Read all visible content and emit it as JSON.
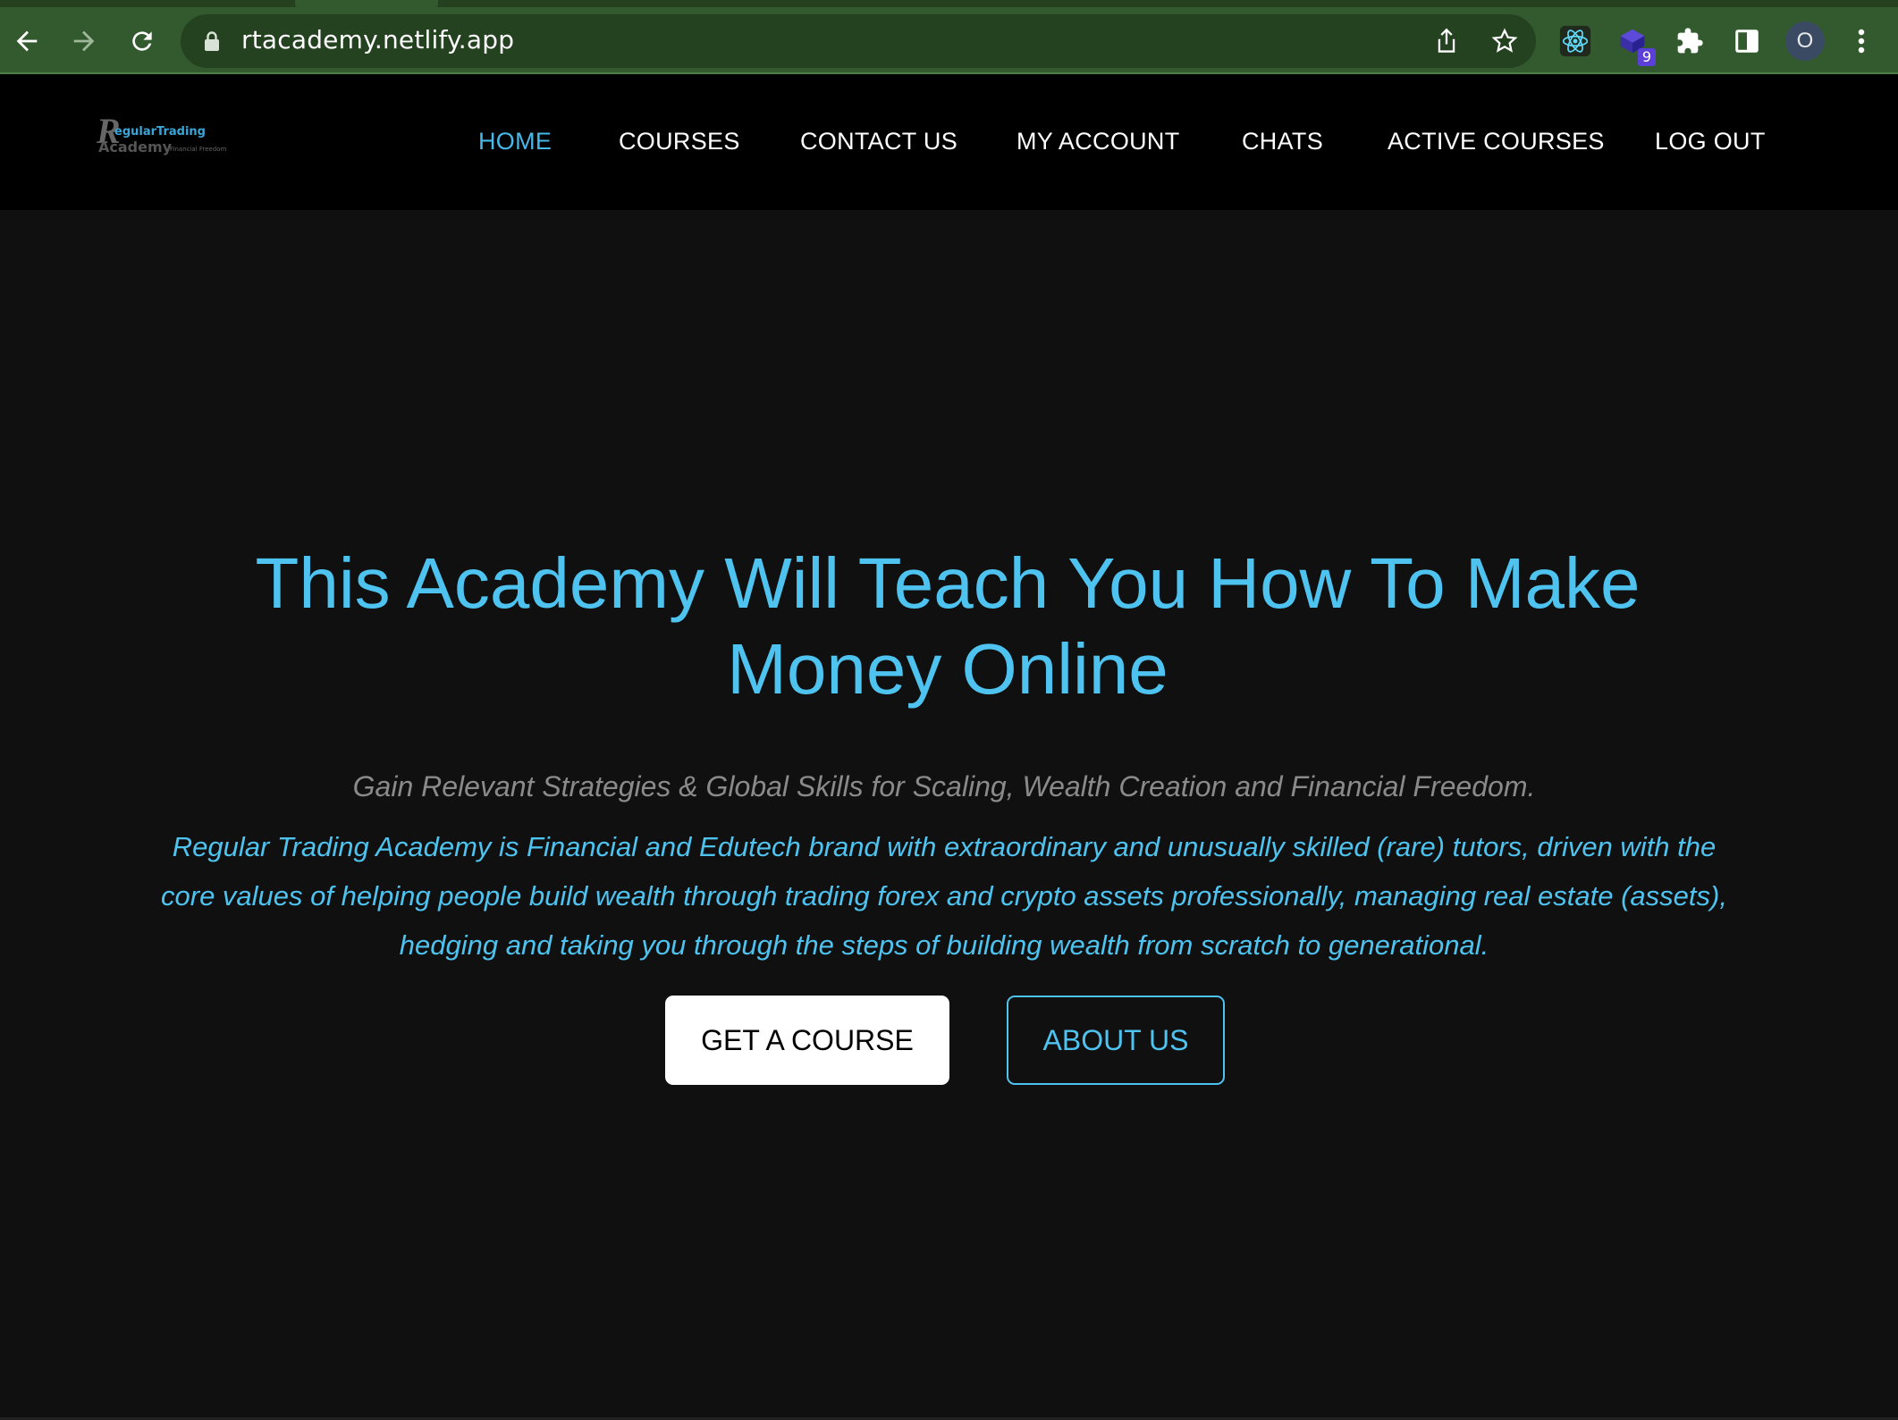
{
  "browser": {
    "url": "rtacademy.netlify.app",
    "extension_badge": "9",
    "profile_initial": "O"
  },
  "site": {
    "logo": {
      "letter": "R",
      "line1": "egularTrading",
      "line2": "Academy",
      "line3": "Financial Freedom"
    },
    "nav": [
      {
        "label": "HOME",
        "active": true
      },
      {
        "label": "COURSES",
        "active": false
      },
      {
        "label": "CONTACT US",
        "active": false
      },
      {
        "label": "MY ACCOUNT",
        "active": false
      },
      {
        "label": "CHATS",
        "active": false
      },
      {
        "label": "ACTIVE COURSES",
        "active": false
      },
      {
        "label": "LOG OUT",
        "active": false
      }
    ]
  },
  "hero": {
    "title_line1": "This Academy Will Teach You How To Make",
    "title_line2": "Money Online",
    "tagline": "Gain Relevant Strategies & Global Skills for Scaling, Wealth Creation and Financial Freedom.",
    "description": "Regular Trading Academy is Financial and Edutech brand with extraordinary and unusually skilled (rare) tutors, driven with the core values of helping people build wealth through trading forex and crypto assets professionally, managing real estate (assets), hedging and taking you through the steps of building wealth from scratch to generational.",
    "primary_button": "GET A COURSE",
    "secondary_button": "ABOUT US"
  },
  "colors": {
    "accent": "#4fc3ef",
    "background": "#101010",
    "navbar": "#000000",
    "chrome": "#335a2e"
  }
}
